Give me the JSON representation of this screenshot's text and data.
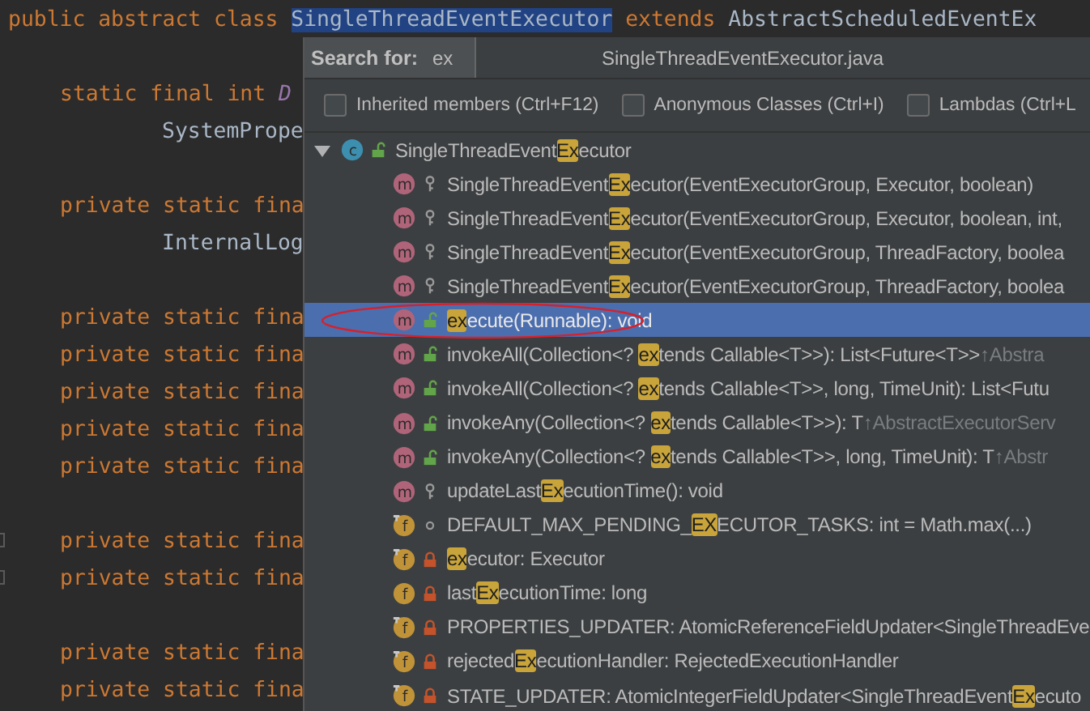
{
  "editor": {
    "lines": [
      {
        "kind": "top",
        "tokens": [
          {
            "text": "public abstract class ",
            "kind": "keyword"
          },
          {
            "text": "SingleThreadEventExecutor",
            "kind": "selected"
          },
          {
            "text": " extends ",
            "kind": "keyword"
          },
          {
            "text": "AbstractScheduledEventEx",
            "kind": "plain"
          }
        ]
      },
      {
        "kind": "blank"
      },
      {
        "kind": "member",
        "tokens": [
          {
            "text": "static final int ",
            "kind": "keyword"
          },
          {
            "text": "D",
            "kind": "constant"
          }
        ]
      },
      {
        "kind": "continuation",
        "tokens": [
          {
            "text": "SystemPrope",
            "kind": "plain"
          }
        ]
      },
      {
        "kind": "blank"
      },
      {
        "kind": "member",
        "tokens": [
          {
            "text": "private static fina",
            "kind": "keyword"
          }
        ]
      },
      {
        "kind": "continuation",
        "tokens": [
          {
            "text": "InternalLog",
            "kind": "plain"
          }
        ]
      },
      {
        "kind": "blank"
      },
      {
        "kind": "member",
        "tokens": [
          {
            "text": "private static fina",
            "kind": "keyword"
          }
        ]
      },
      {
        "kind": "member",
        "tokens": [
          {
            "text": "private static fina",
            "kind": "keyword"
          }
        ]
      },
      {
        "kind": "member",
        "tokens": [
          {
            "text": "private static fina",
            "kind": "keyword"
          }
        ]
      },
      {
        "kind": "member",
        "tokens": [
          {
            "text": "private static fina",
            "kind": "keyword"
          }
        ]
      },
      {
        "kind": "member",
        "tokens": [
          {
            "text": "private static fina",
            "kind": "keyword"
          }
        ]
      },
      {
        "kind": "blank"
      },
      {
        "kind": "member",
        "fold": true,
        "tokens": [
          {
            "text": "private static fina",
            "kind": "keyword"
          }
        ]
      },
      {
        "kind": "member",
        "fold": true,
        "tokens": [
          {
            "text": "private static fina",
            "kind": "keyword"
          }
        ]
      },
      {
        "kind": "blank"
      },
      {
        "kind": "member",
        "tokens": [
          {
            "text": "private static fina",
            "kind": "keyword"
          }
        ]
      },
      {
        "kind": "member",
        "tokens": [
          {
            "text": "private static fina",
            "kind": "keyword"
          }
        ]
      }
    ]
  },
  "structure_popup": {
    "search_label": "Search for:",
    "query": "ex",
    "file_name": "SingleThreadEventExecutor.java",
    "options": [
      {
        "label": "Inherited members (Ctrl+F12)",
        "checked": false
      },
      {
        "label": "Anonymous Classes (Ctrl+I)",
        "checked": false
      },
      {
        "label": "Lambdas (Ctrl+L",
        "checked": false
      }
    ],
    "tree": [
      {
        "kind": "class",
        "badge": "c",
        "modifier": {
          "kind": "public"
        },
        "static": false,
        "expanded": true,
        "selected": false,
        "circled": false,
        "pre": "SingleThreadEvent",
        "match": "Ex",
        "post": "ecutor",
        "children": [
          {
            "kind": "method",
            "badge": "m",
            "modifier": {
              "kind": "protected"
            },
            "static": false,
            "selected": false,
            "circled": false,
            "pre": "SingleThreadEvent",
            "match": "Ex",
            "post": "ecutor(EventExecutorGroup, Executor, boolean)"
          },
          {
            "kind": "method",
            "badge": "m",
            "modifier": {
              "kind": "protected"
            },
            "static": false,
            "selected": false,
            "circled": false,
            "pre": "SingleThreadEvent",
            "match": "Ex",
            "post": "ecutor(EventExecutorGroup, Executor, boolean, int,"
          },
          {
            "kind": "method",
            "badge": "m",
            "modifier": {
              "kind": "protected"
            },
            "static": false,
            "selected": false,
            "circled": false,
            "pre": "SingleThreadEvent",
            "match": "Ex",
            "post": "ecutor(EventExecutorGroup, ThreadFactory, boolea"
          },
          {
            "kind": "method",
            "badge": "m",
            "modifier": {
              "kind": "protected"
            },
            "static": false,
            "selected": false,
            "circled": false,
            "pre": "SingleThreadEvent",
            "match": "Ex",
            "post": "ecutor(EventExecutorGroup, ThreadFactory, boolea"
          },
          {
            "kind": "method",
            "badge": "m",
            "modifier": {
              "kind": "public"
            },
            "static": false,
            "selected": true,
            "circled": true,
            "match": "ex",
            "post": "ecute(Runnable): void"
          },
          {
            "kind": "method",
            "badge": "m",
            "modifier": {
              "kind": "public"
            },
            "static": false,
            "selected": false,
            "circled": false,
            "pre": "invokeAll(Collection<? ",
            "match": "ex",
            "post": "tends Callable<T>>): List<Future<T>>",
            "inherited": "↑Abstra"
          },
          {
            "kind": "method",
            "badge": "m",
            "modifier": {
              "kind": "public"
            },
            "static": false,
            "selected": false,
            "circled": false,
            "pre": "invokeAll(Collection<? ",
            "match": "ex",
            "post": "tends Callable<T>>, long, TimeUnit): List<Futu"
          },
          {
            "kind": "method",
            "badge": "m",
            "modifier": {
              "kind": "public"
            },
            "static": false,
            "selected": false,
            "circled": false,
            "pre": "invokeAny(Collection<? ",
            "match": "ex",
            "post": "tends Callable<T>>): T",
            "inherited": "↑AbstractExecutorServ"
          },
          {
            "kind": "method",
            "badge": "m",
            "modifier": {
              "kind": "public"
            },
            "static": false,
            "selected": false,
            "circled": false,
            "pre": "invokeAny(Collection<? ",
            "match": "ex",
            "post": "tends Callable<T>>, long, TimeUnit): T",
            "inherited": "↑Abstr"
          },
          {
            "kind": "method",
            "badge": "m",
            "modifier": {
              "kind": "protected"
            },
            "static": false,
            "selected": false,
            "circled": false,
            "pre": "updateLast",
            "match": "Ex",
            "post": "ecutionTime(): void"
          },
          {
            "kind": "field",
            "badge": "f",
            "modifier": {
              "kind": "package"
            },
            "static": true,
            "selected": false,
            "circled": false,
            "pre": "DEFAULT_MAX_PENDING_",
            "match": "EX",
            "post": "ECUTOR_TASKS: int = Math.max(...)"
          },
          {
            "kind": "field",
            "badge": "f",
            "modifier": {
              "kind": "private"
            },
            "static": true,
            "selected": false,
            "circled": false,
            "match": "ex",
            "post": "ecutor: Executor"
          },
          {
            "kind": "field",
            "badge": "f",
            "modifier": {
              "kind": "private"
            },
            "static": false,
            "selected": false,
            "circled": false,
            "pre": "last",
            "match": "Ex",
            "post": "ecutionTime: long"
          },
          {
            "kind": "field",
            "badge": "f",
            "modifier": {
              "kind": "private"
            },
            "static": true,
            "selected": false,
            "circled": false,
            "pre": "PROPERTIES_UPDATER: AtomicReferenceFieldUpdater<SingleThreadEve"
          },
          {
            "kind": "field",
            "badge": "f",
            "modifier": {
              "kind": "private"
            },
            "static": true,
            "selected": false,
            "circled": false,
            "pre": "rejected",
            "match": "Ex",
            "post": "ecutionHandler: RejectedExecutionHandler"
          },
          {
            "kind": "field",
            "badge": "f",
            "modifier": {
              "kind": "private"
            },
            "static": true,
            "selected": false,
            "circled": false,
            "pre": "STATE_UPDATER: AtomicIntegerFieldUpdater<SingleThreadEvent",
            "match": "Ex",
            "post": "ecuto"
          }
        ]
      }
    ]
  }
}
